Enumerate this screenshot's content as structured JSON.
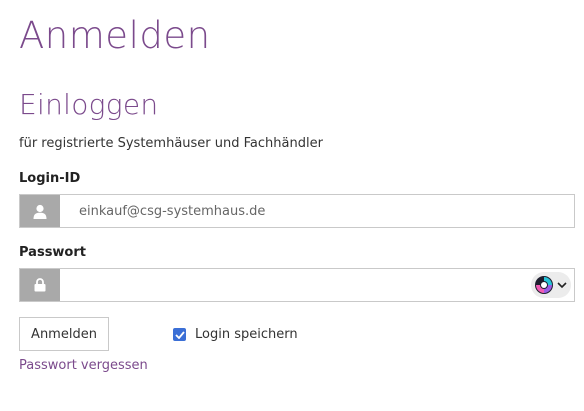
{
  "page": {
    "title": "Anmelden"
  },
  "login": {
    "heading": "Einloggen",
    "subtitle": "für registrierte Systemhäuser und Fachhändler",
    "login_id_label": "Login-ID",
    "login_id_value": "einkauf@csg-systemhaus.de",
    "password_label": "Passwort",
    "password_value": "",
    "submit_label": "Anmelden",
    "remember_label": "Login speichern",
    "remember_checked": true,
    "forgot_label": "Passwort vergessen"
  },
  "icons": {
    "user": "user-icon",
    "lock": "lock-icon",
    "password_manager": "password-manager-icon",
    "dropdown": "chevron-down-icon",
    "check": "checkmark-icon"
  },
  "colors": {
    "accent": "#7b4a8c",
    "addon_bg": "#a9a9a9",
    "checkbox": "#3b6fd6"
  }
}
